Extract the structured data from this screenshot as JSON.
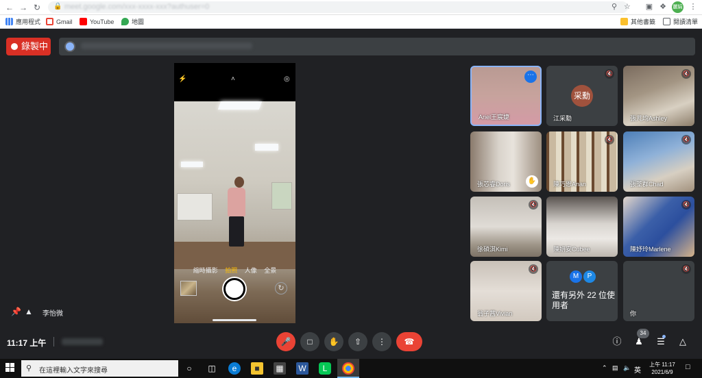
{
  "browser": {
    "url": "meet.google.com/xxx-xxxx-xxx?authuser=0",
    "bookmarks": [
      "應用程式",
      "Gmail",
      "YouTube",
      "地圖"
    ],
    "bookmarks_right": [
      "其他書籤",
      "閱讀清單"
    ],
    "profile_initials": "麗娟"
  },
  "meet": {
    "recording_label": "錄製中",
    "presenter_name": "李怡微",
    "camera_modes": [
      "縮時攝影",
      "拍照",
      "人像",
      "全景"
    ],
    "participants": [
      {
        "name": "Ariel王宸婕"
      },
      {
        "name": "江采勳",
        "avatar_text": "采勳"
      },
      {
        "name": "張芃均Ashley"
      },
      {
        "name": "張芯睿Doris"
      },
      {
        "name": "陳巧恩Anan"
      },
      {
        "name": "張荃群Chad"
      },
      {
        "name": "徐碩淇Kimi"
      },
      {
        "name": "陳妍安Cubee"
      },
      {
        "name": "陳妤玲Marlene"
      },
      {
        "name": "翁子茜Vivian"
      },
      {
        "name": "還有另外 22 位使用者",
        "avatars": [
          "M",
          "P"
        ]
      },
      {
        "name": "你"
      }
    ],
    "clock": "11:17 上午",
    "participant_count": "34"
  },
  "taskbar": {
    "search_placeholder": "在這裡輸入文字來搜尋",
    "ime": "英",
    "time": "上午 11:17",
    "date": "2021/6/9"
  },
  "colors": {
    "meet_bg": "#202124",
    "tile_bg": "#3c4043",
    "record_red": "#d93025",
    "accent_blue": "#8ab4f8"
  }
}
